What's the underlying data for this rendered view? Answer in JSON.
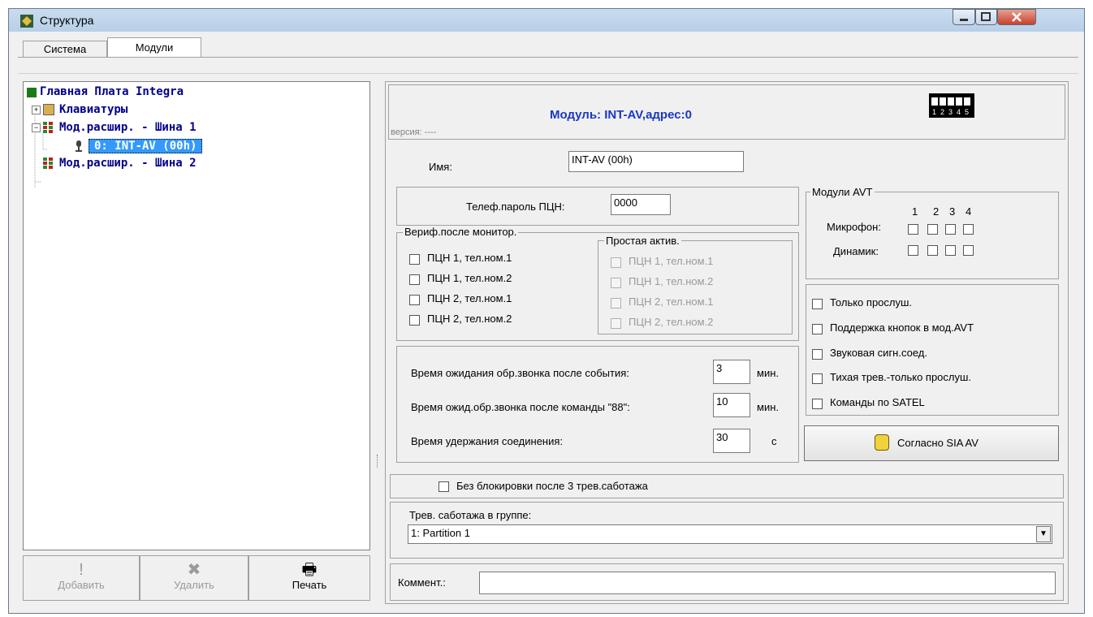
{
  "window": {
    "title": "Структура"
  },
  "tabs": [
    {
      "label": "Система"
    },
    {
      "label": "Модули"
    }
  ],
  "tree": [
    {
      "label": "Главная Плата Integra"
    },
    {
      "label": "Клавиатуры"
    },
    {
      "label": "Мод.расшир. - Шина 1"
    },
    {
      "label": "0: INT-AV (00h)"
    },
    {
      "label": "Мод.расшир. - Шина 2"
    }
  ],
  "bottom_buttons": {
    "add": "Добавить",
    "delete": "Удалить",
    "print": "Печать"
  },
  "module": {
    "header": "Модуль: INT-AV,адрес:0",
    "version": "версия: ----",
    "dip_labels": [
      "1",
      "2",
      "3",
      "4",
      "5"
    ],
    "name_label": "Имя:",
    "name_value": "INT-AV (00h)",
    "tel_password_label": "Телеф.пароль ПЦН:",
    "tel_password_value": "0000",
    "verif_group": {
      "title": "Вериф.после монитор.",
      "items": [
        "ПЦН 1, тел.ном.1",
        "ПЦН 1, тел.ном.2",
        "ПЦН 2, тел.ном.1",
        "ПЦН 2, тел.ном.2"
      ]
    },
    "simple_group": {
      "title": "Простая актив.",
      "items": [
        "ПЦН 1, тел.ном.1",
        "ПЦН 1, тел.ном.2",
        "ПЦН 2, тел.ном.1",
        "ПЦН 2, тел.ном.2"
      ]
    },
    "avt": {
      "title": "Модули AVT",
      "cols": [
        "1",
        "2",
        "3",
        "4"
      ],
      "mic": "Микрофон:",
      "spk": "Динамик:"
    },
    "options": [
      "Только прослуш.",
      "Поддержка кнопок в мод.AVT",
      "Звуковая сигн.соед.",
      "Тихая трев.-только прослуш.",
      "Команды по SATEL"
    ],
    "times": [
      {
        "label": "Время ожидания обр.звонка после события:",
        "value": "3",
        "unit": "мин."
      },
      {
        "label": "Время ожид.обр.звонка после команды \"88\":",
        "value": "10",
        "unit": "мин."
      },
      {
        "label": "Время удержания соединения:",
        "value": "30",
        "unit": "с"
      }
    ],
    "sia_button": "Согласно SIA AV",
    "no_block_label": "Без блокировки после 3 трев.саботажа",
    "tamper_label": "Трев. саботажа в группе:",
    "tamper_value": "1: Partition  1",
    "comment_label": "Коммент.:",
    "comment_value": ""
  },
  "colors": {
    "tree_text": "#00008b",
    "selection": "#3399ff",
    "header_text": "#1a37c8"
  }
}
